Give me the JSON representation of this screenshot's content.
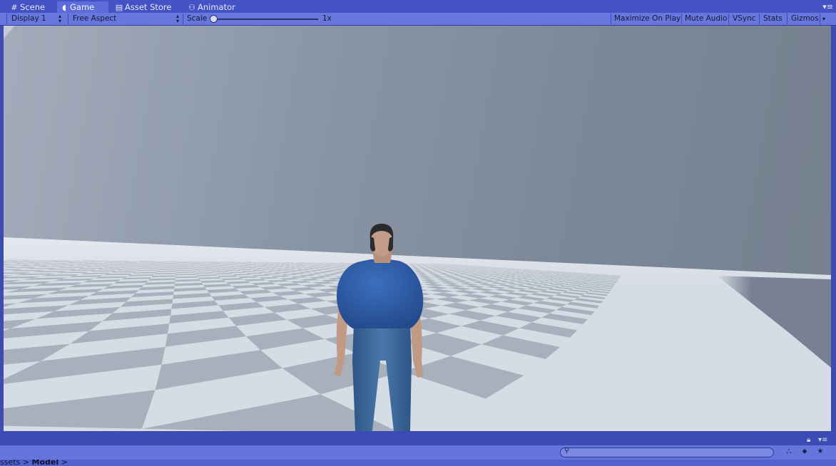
{
  "tabs": [
    {
      "label": "Scene",
      "icon": "grid-icon"
    },
    {
      "label": "Game",
      "icon": "pacman-icon",
      "active": true
    },
    {
      "label": "Asset Store",
      "icon": "store-icon"
    },
    {
      "label": "Animator",
      "icon": "animator-icon"
    }
  ],
  "toolbar": {
    "display": "Display 1",
    "aspect": "Free Aspect",
    "scale_label": "Scale",
    "scale_value": "1x",
    "maximize": "Maximize On Play",
    "mute": "Mute Audio",
    "vsync": "VSync",
    "stats": "Stats",
    "gizmos": "Gizmos"
  },
  "project": {
    "breadcrumb_1": "ssets",
    "breadcrumb_2": "Model",
    "sep": ">"
  },
  "colors": {
    "accent": "#4352c4",
    "sky": "#8592a3",
    "floor_light": "#d7dde6",
    "floor_dark": "#a9b1bd",
    "shirt": "#2e5da8",
    "jeans": "#3d6a9e"
  }
}
